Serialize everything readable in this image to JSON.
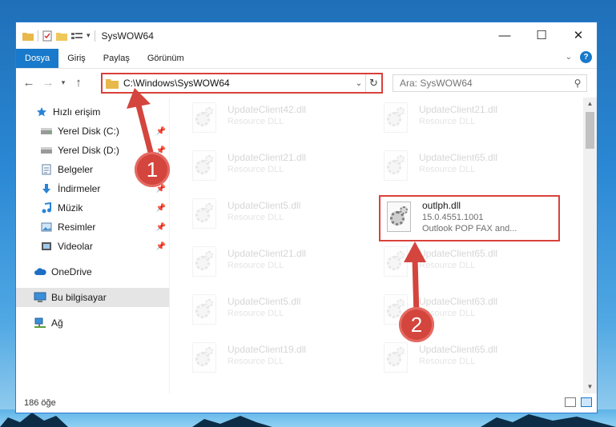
{
  "window": {
    "title": "SysWOW64",
    "controls": {
      "minimize": "—",
      "maximize": "☐",
      "close": "✕"
    }
  },
  "ribbon": {
    "tabs": [
      "Dosya",
      "Giriş",
      "Paylaş",
      "Görünüm"
    ],
    "active_tab": "Dosya",
    "help": "?"
  },
  "address": {
    "path": "C:\\Windows\\SysWOW64",
    "search_placeholder": "Ara: SysWOW64"
  },
  "sidebar": {
    "items": [
      {
        "label": "Hızlı erişim",
        "icon": "star-icon",
        "pinned": false
      },
      {
        "label": "Yerel Disk (C:)",
        "icon": "drive-icon",
        "pinned": true
      },
      {
        "label": "Yerel Disk (D:)",
        "icon": "drive-icon",
        "pinned": true
      },
      {
        "label": "Belgeler",
        "icon": "documents-icon",
        "pinned": true
      },
      {
        "label": "İndirmeler",
        "icon": "download-icon",
        "pinned": true
      },
      {
        "label": "Müzik",
        "icon": "music-icon",
        "pinned": true
      },
      {
        "label": "Resimler",
        "icon": "pictures-icon",
        "pinned": true
      },
      {
        "label": "Videolar",
        "icon": "videos-icon",
        "pinned": true
      },
      {
        "label": "OneDrive",
        "icon": "cloud-icon",
        "pinned": false
      },
      {
        "label": "Bu bilgisayar",
        "icon": "computer-icon",
        "pinned": false
      },
      {
        "label": "Ağ",
        "icon": "network-icon",
        "pinned": false
      }
    ],
    "selected": "Bu bilgisayar"
  },
  "files": [
    {
      "name": "UpdateClient42.dll",
      "desc": "Resource DLL"
    },
    {
      "name": "UpdateClient21.dll",
      "desc": "Resource DLL"
    },
    {
      "name": "UpdateClient21.dll",
      "desc": "Resource DLL"
    },
    {
      "name": "UpdateClient65.dll",
      "desc": "Resource DLL"
    },
    {
      "name": "UpdateClient5.dll",
      "desc": "Resource DLL"
    },
    {
      "name": "outlph.dll",
      "version": "15.0.4551.1001",
      "desc": "Outlook POP FAX and..."
    },
    {
      "name": "UpdateClient21.dll",
      "desc": "Resource DLL"
    },
    {
      "name": "UpdateClient65.dll",
      "desc": "Resource DLL"
    },
    {
      "name": "UpdateClient5.dll",
      "desc": "Resource DLL"
    },
    {
      "name": "UpdateClient63.dll",
      "desc": "Resource DLL"
    },
    {
      "name": "UpdateClient19.dll",
      "desc": "Resource DLL"
    },
    {
      "name": "UpdateClient65.dll",
      "desc": "Resource DLL"
    }
  ],
  "status": {
    "count": "186 öğe"
  },
  "callouts": [
    "1",
    "2"
  ],
  "colors": {
    "accent": "#1979ca",
    "highlight": "#d9413a",
    "badge": "#d3453d"
  }
}
